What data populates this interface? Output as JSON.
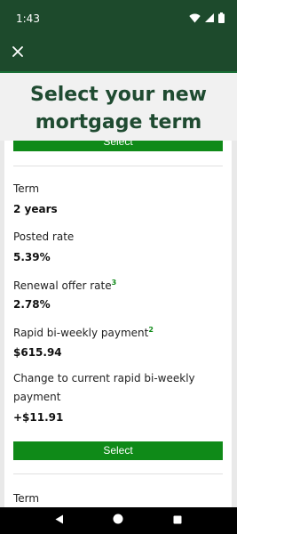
{
  "status_bar": {
    "time": "1:43",
    "icons": [
      "wifi-icon",
      "signal-icon",
      "battery-icon"
    ]
  },
  "app_bar": {
    "close_icon": "close-icon"
  },
  "header": {
    "title": "Select your new mortgage term"
  },
  "card": {
    "top_button_label": "Select",
    "term_label": "Term",
    "term_value": "2 years",
    "posted_rate_label": "Posted rate",
    "posted_rate_value": "5.39%",
    "renewal_label": "Renewal offer rate",
    "renewal_note": "3",
    "renewal_value": "2.78%",
    "payment_label": "Rapid bi-weekly payment",
    "payment_note": "2",
    "payment_value": "$615.94",
    "change_label": "Change to current rapid bi-weekly payment",
    "change_value": "+$11.91",
    "select_label": "Select",
    "next_term_label": "Term"
  },
  "nav_bar": {
    "icons": [
      "back-icon",
      "home-icon",
      "recents-icon"
    ]
  },
  "colors": {
    "brand_dark": "#1d4a2c",
    "accent_green": "#0f8a18",
    "title_green": "#1f4b31"
  }
}
